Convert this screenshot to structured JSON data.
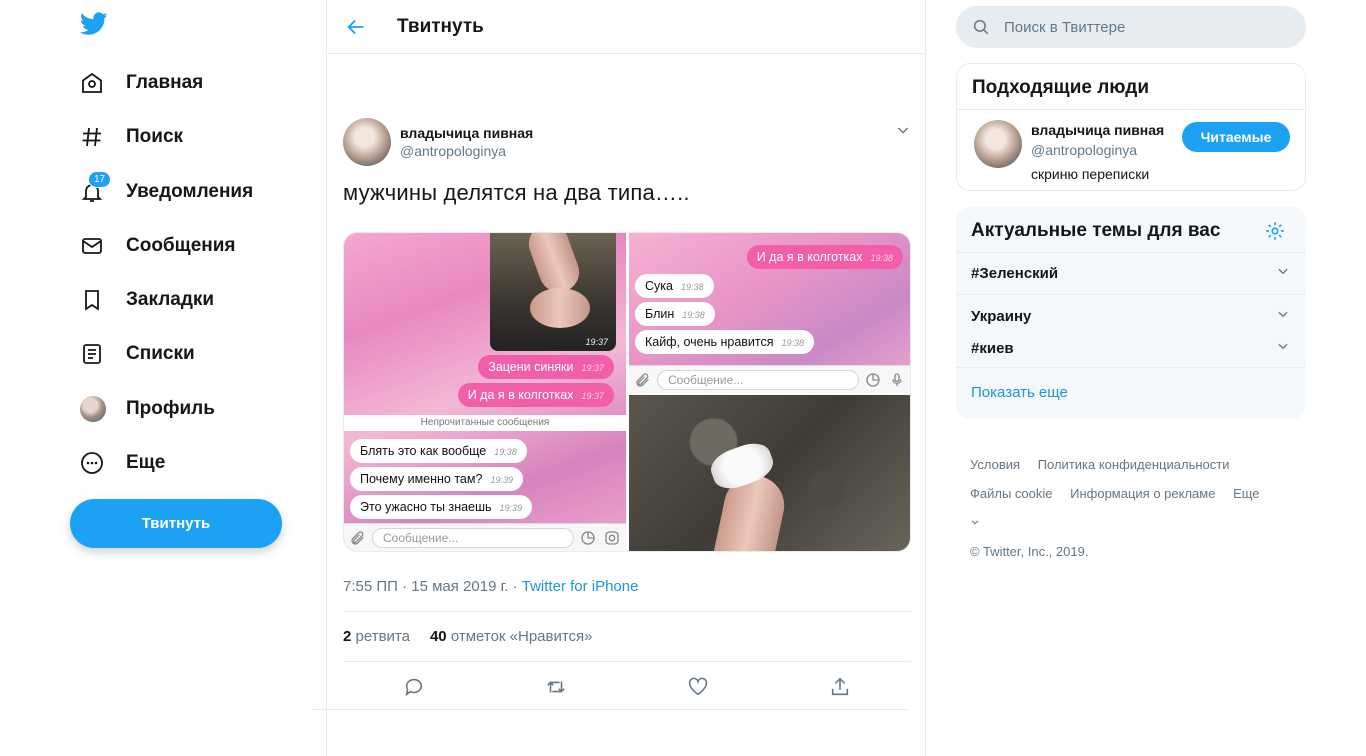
{
  "nav": {
    "items": [
      {
        "label": "Главная",
        "icon": "home-icon"
      },
      {
        "label": "Поиск",
        "icon": "hashtag-icon"
      },
      {
        "label": "Уведомления",
        "icon": "bell-icon",
        "badge": "17"
      },
      {
        "label": "Сообщения",
        "icon": "mail-icon"
      },
      {
        "label": "Закладки",
        "icon": "bookmark-icon"
      },
      {
        "label": "Списки",
        "icon": "list-icon"
      },
      {
        "label": "Профиль",
        "icon": "avatar"
      },
      {
        "label": "Еще",
        "icon": "more-icon"
      }
    ],
    "tweet_button": "Твитнуть"
  },
  "header": {
    "title": "Твитнуть"
  },
  "tweet": {
    "author_name": "владычица пивная",
    "author_handle": "@antropologinya",
    "text": "мужчины делятся на два типа…..",
    "timestamp": "7:55 ПП · 15 мая 2019 г. · ",
    "source": "Twitter for iPhone",
    "retweets": "2",
    "retweets_label": "ретвита",
    "likes": "40",
    "likes_label": "отметок «Нравится»"
  },
  "media": {
    "left": {
      "phone_time": "19:37",
      "out_messages": [
        {
          "text": "Зацени синяки",
          "time": "19:37"
        },
        {
          "text": "И да я в колготках",
          "time": "19:37"
        }
      ],
      "unread_label": "Непрочитанные сообщения",
      "in_messages": [
        {
          "text": "Блять это как вообще",
          "time": "19:38"
        },
        {
          "text": "Почему именно там?",
          "time": "19:39"
        },
        {
          "text": "Это ужасно ты знаешь",
          "time": "19:39"
        }
      ],
      "composer_placeholder": "Сообщение..."
    },
    "right_top": {
      "out_message": {
        "text": "И да я в колготках",
        "time": "19:38"
      },
      "in_messages": [
        {
          "text": "Сука",
          "time": "19:38"
        },
        {
          "text": "Блин",
          "time": "19:38"
        },
        {
          "text": "Кайф, очень нравится",
          "time": "19:38"
        }
      ],
      "composer_placeholder": "Сообщение..."
    }
  },
  "sidebar": {
    "search_placeholder": "Поиск в Твиттере",
    "who_title": "Подходящие люди",
    "who": {
      "name": "владычица пивная",
      "handle": "@antropologinya",
      "bio": "скриню переписки",
      "button": "Читаемые"
    },
    "trends_title": "Актуальные темы для вас",
    "trends": [
      "#Зеленский",
      "Украину",
      "#киев"
    ],
    "show_more": "Показать еще",
    "footer": {
      "line1": [
        "Условия",
        "Политика конфиденциальности"
      ],
      "line2": [
        "Файлы cookie",
        "Информация о рекламе",
        "Еще"
      ],
      "copyright": "© Twitter, Inc., 2019."
    }
  },
  "colors": {
    "accent": "#1da1f2",
    "link": "#1b95e0",
    "muted": "#657786",
    "bubble_out": "#f25ea8"
  }
}
